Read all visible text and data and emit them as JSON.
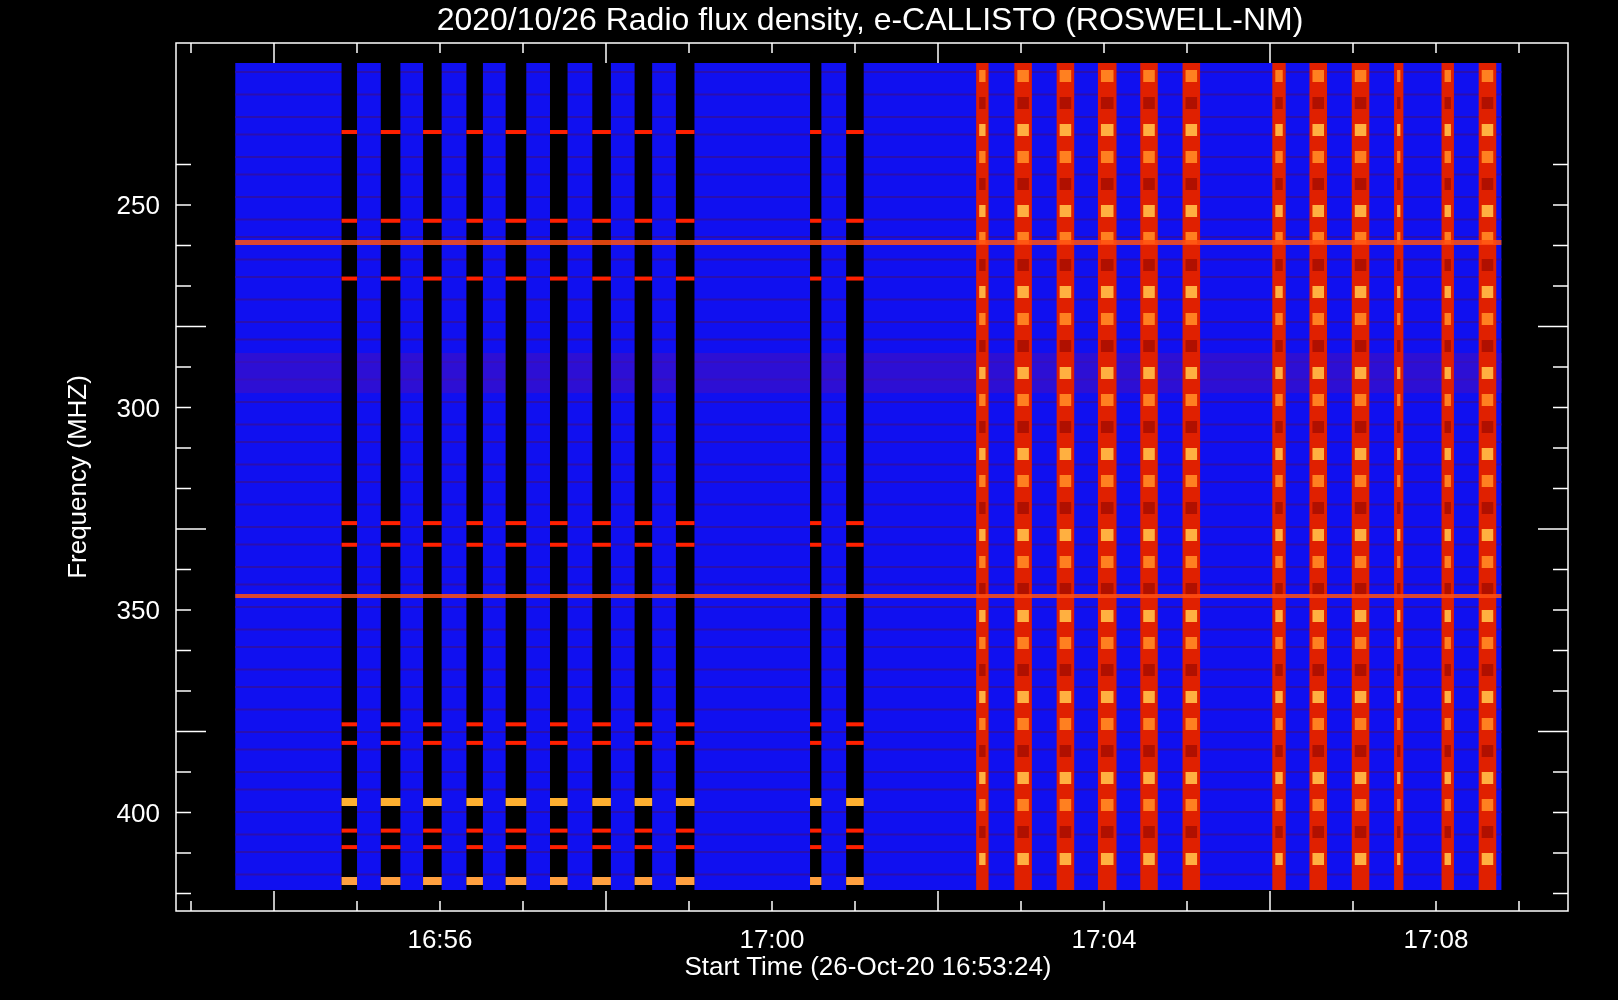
{
  "title": "2020/10/26  Radio flux density, e-CALLISTO (ROSWELL-NM)",
  "xlabel": "Start Time (26-Oct-20 16:53:24)",
  "ylabel": "Frequency (MHZ)",
  "xtick_labels": [
    "16:56",
    "17:00",
    "17:04",
    "17:08"
  ],
  "ytick_labels": [
    "250",
    "300",
    "350",
    "400"
  ]
}
